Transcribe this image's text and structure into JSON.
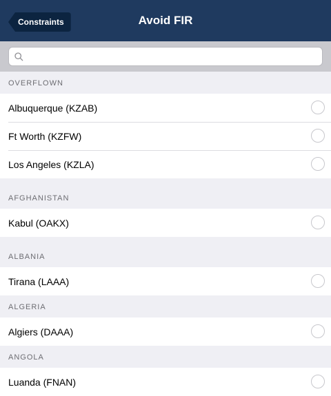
{
  "navbar": {
    "back_label": "Constraints",
    "title": "Avoid FIR"
  },
  "search": {
    "placeholder": "",
    "value": ""
  },
  "sections": [
    {
      "header": "OVERFLOWN",
      "items": [
        "Albuquerque (KZAB)",
        "Ft Worth (KZFW)",
        "Los Angeles (KZLA)"
      ]
    },
    {
      "header": "AFGHANISTAN",
      "items": [
        "Kabul (OAKX)"
      ]
    },
    {
      "header": "ALBANIA",
      "items": [
        "Tirana (LAAA)"
      ]
    },
    {
      "header": "ALGERIA",
      "items": [
        "Algiers (DAAA)"
      ]
    },
    {
      "header": "ANGOLA",
      "items": [
        "Luanda (FNAN)"
      ]
    }
  ],
  "colors": {
    "navbar": "#1f3a5f",
    "back_button": "#0c2440",
    "section_text": "#6d6d72",
    "background": "#efeff4"
  }
}
